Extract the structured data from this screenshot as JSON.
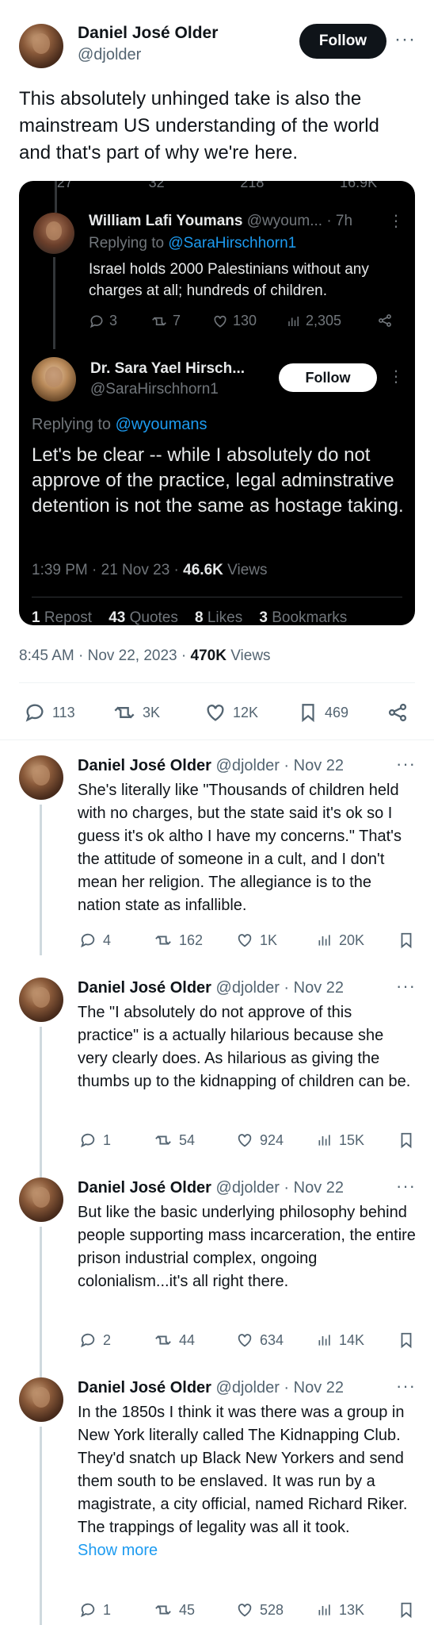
{
  "main_tweet": {
    "author_name": "Daniel José Older",
    "author_handle": "@djolder",
    "follow_label": "Follow",
    "text": "This absolutely unhinged take is also the mainstream US understanding of the world and that's part of why we're here.",
    "time": "8:45 AM · Nov 22, 2023 · ",
    "views_count": "470K",
    "views_label": " Views",
    "actions": {
      "replies": "113",
      "reposts": "3K",
      "likes": "12K",
      "bookmarks": "469"
    }
  },
  "quoted": {
    "top_stats": [
      "27",
      "32",
      "218",
      "16.9K"
    ],
    "reply1": {
      "name": "William Lafi Youmans",
      "handle": " @wyoum...",
      "time": "· 7h",
      "replying_prefix": "Replying to ",
      "replying_to": "@SaraHirschhorn1",
      "text": "Israel holds 2000 Palestinians without any charges at all; hundreds of children.",
      "replies": "3",
      "reposts": "7",
      "likes": "130",
      "views": "2,305"
    },
    "main": {
      "name": "Dr. Sara Yael Hirsch...",
      "handle": "@SaraHirschhorn1",
      "follow_label": "Follow",
      "replying_prefix": "Replying to ",
      "replying_to": "@wyoumans",
      "text": "Let's be clear -- while I absolutely do  not approve of the practice, legal adminstrative detention is not the same as hostage taking.",
      "time": "1:39 PM · 21 Nov 23 · ",
      "views_count": "46.6K",
      "views_label": " Views",
      "repost_count": "1",
      "repost_label": " Repost",
      "quotes_count": "43",
      "quotes_label": " Quotes",
      "likes_count": "8",
      "likes_label": " Likes",
      "bookmarks_count": "3",
      "bookmarks_label": " Bookmarks"
    }
  },
  "replies": [
    {
      "name": "Daniel José Older",
      "handle": " @djolder · Nov 22",
      "text": "She's literally like \"Thousands of children held with no charges, but the state said it's ok so I guess it's ok altho I have my concerns.\" That's the attitude of someone in a cult, and I don't mean her religion. The allegiance is to the nation state as infallible.",
      "replies": "4",
      "reposts": "162",
      "likes": "1K",
      "views": "20K"
    },
    {
      "name": "Daniel José Older",
      "handle": " @djolder · Nov 22",
      "text": "The \"I absolutely do not approve of this practice\" is a actually hilarious because she very clearly does. As hilarious as giving the thumbs up to the kidnapping of children can be.",
      "replies": "1",
      "reposts": "54",
      "likes": "924",
      "views": "15K"
    },
    {
      "name": "Daniel José Older",
      "handle": " @djolder · Nov 22",
      "text": "But like the basic underlying philosophy behind people supporting mass incarceration, the entire prison industrial complex, ongoing colonialism...it's all right there.",
      "replies": "2",
      "reposts": "44",
      "likes": "634",
      "views": "14K"
    },
    {
      "name": "Daniel José Older",
      "handle": " @djolder · Nov 22",
      "text": "In the 1850s I think it was there was a group in New York literally called The Kidnapping Club. They'd snatch up Black New Yorkers and send them south to be enslaved. It was run by a magistrate, a city official, named Richard Riker. The trappings of legality was all it took.",
      "show_more": "Show more",
      "replies": "1",
      "reposts": "45",
      "likes": "528",
      "views": "13K"
    }
  ],
  "icons": [
    "reply-icon",
    "repost-icon",
    "like-icon",
    "views-icon",
    "bookmark-icon",
    "share-icon",
    "more-icon"
  ]
}
